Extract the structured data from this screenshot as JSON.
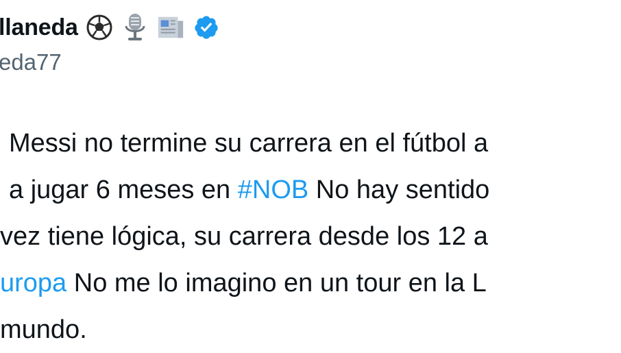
{
  "tweet": {
    "display_name": "llaneda",
    "handle": "eda77",
    "icons": [
      "soccer-ball-icon",
      "microphone-icon",
      "newspaper-icon",
      "verified-badge-icon"
    ],
    "colors": {
      "text": "#0f1419",
      "secondary": "#536471",
      "link": "#1d9bf0",
      "verified": "#1d9bf0"
    },
    "lines": [
      {
        "pre": "Messi no termine su carrera en el fútbol a",
        "link": "",
        "post": ""
      },
      {
        "pre": "a jugar 6 meses en ",
        "link": "#NOB",
        "post": " No hay sentido"
      },
      {
        "pre": "vez tiene lógica, su carrera desde los 12 a",
        "link": "",
        "post": ""
      },
      {
        "pre": "",
        "link": "uropa",
        "post": " No me lo imagino en un tour en la L"
      },
      {
        "pre": "mundo.",
        "link": "",
        "post": ""
      }
    ]
  }
}
